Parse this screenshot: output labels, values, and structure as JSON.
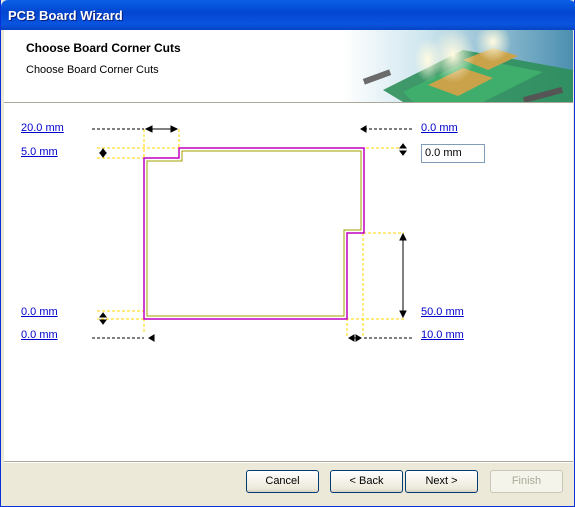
{
  "window": {
    "title": "PCB Board Wizard"
  },
  "header": {
    "title": "Choose Board Corner Cuts",
    "subtitle": "Choose Board Corner Cuts"
  },
  "dimensions": {
    "top_left_width": "20.0 mm",
    "top_left_height": "5.0 mm",
    "top_right_width": "0.0 mm",
    "top_right_height_value": "0.0 mm",
    "bottom_left_height": "0.0 mm",
    "bottom_left_width": "0.0 mm",
    "bottom_right_height": "50.0 mm",
    "bottom_right_width": "10.0 mm"
  },
  "buttons": {
    "cancel": "Cancel",
    "back": "< Back",
    "next": "Next >",
    "finish": "Finish"
  },
  "colors": {
    "board_outline": "#c000c0",
    "board_inner_outline": "#a0a000",
    "guide_lines": "#ffd700",
    "link": "#0000cc"
  }
}
